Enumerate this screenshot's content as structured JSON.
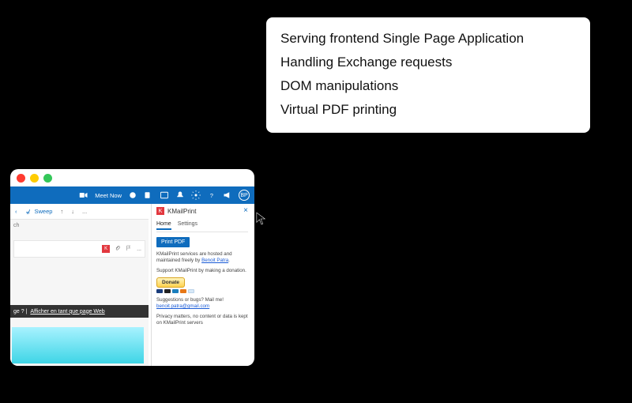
{
  "info_box": {
    "lines": [
      "Serving frontend Single Page Application",
      "Handling Exchange requests",
      "DOM manipulations",
      "Virtual PDF printing"
    ]
  },
  "outlook_bar": {
    "meet_label": "Meet Now",
    "avatar_initials": "BP"
  },
  "mail": {
    "toolbar": {
      "sweep_label": "Sweep",
      "dots": "..."
    },
    "left_hint": "ch",
    "dark_bar_prefix": "ge ?  |  ",
    "dark_bar_link": "Afficher en tant que page Web"
  },
  "panel": {
    "title": "KMailPrint",
    "tabs": {
      "home": "Home",
      "settings": "Settings"
    },
    "print_button": "Print PDF",
    "hosted_text_prefix": "KMailPrint services are hosted and maintained freely by  ",
    "hosted_link": "Benoit Patra",
    "hosted_text_suffix": ".",
    "support_text": "Support KMailPrint by making a donation.",
    "donate_label": "Donate",
    "suggestions_text": "Suggestions or bugs? Mail me!",
    "suggestions_link": "benoit.patra@gmail.com",
    "privacy_text": "Privacy matters, no content or data is kept on KMailPrint servers"
  }
}
